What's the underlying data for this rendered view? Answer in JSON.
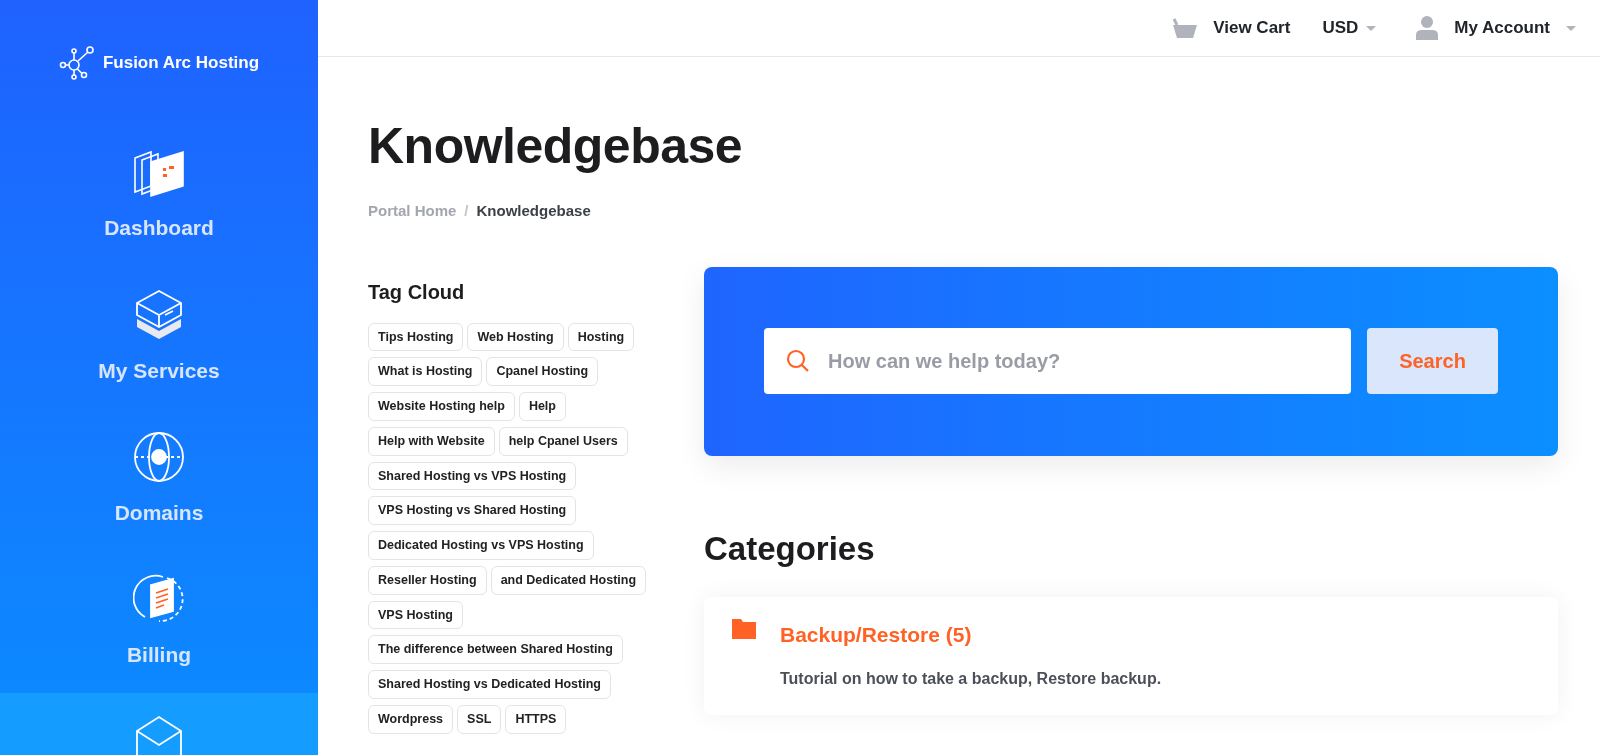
{
  "brand": {
    "name": "Fusion Arc Hosting"
  },
  "sidebar": {
    "items": [
      {
        "label": "Dashboard",
        "selected": false
      },
      {
        "label": "My Services",
        "selected": false
      },
      {
        "label": "Domains",
        "selected": false
      },
      {
        "label": "Billing",
        "selected": false
      },
      {
        "selected": true
      }
    ]
  },
  "topbar": {
    "cart": "View Cart",
    "currency": "USD",
    "account": "My Account"
  },
  "page": {
    "title": "Knowledgebase",
    "breadcrumb_separator": "/",
    "breadcrumb": [
      {
        "label": "Portal Home",
        "active": false
      },
      {
        "label": "Knowledgebase",
        "active": true
      }
    ]
  },
  "tag_cloud": {
    "title": "Tag Cloud",
    "tags": [
      "Tips Hosting",
      "Web Hosting",
      "Hosting",
      "What is Hosting",
      "Cpanel Hosting",
      "Website Hosting help",
      "Help",
      "Help with Website",
      "help Cpanel Users",
      "Shared Hosting vs VPS Hosting",
      "VPS Hosting vs Shared Hosting",
      "Dedicated Hosting vs VPS Hosting",
      "Reseller Hosting",
      "and Dedicated Hosting",
      "VPS Hosting",
      "The difference between Shared Hosting",
      "Shared Hosting vs Dedicated Hosting",
      "Wordpress",
      "SSL",
      "HTTPS"
    ]
  },
  "search": {
    "placeholder": "How can we help today?",
    "button": "Search"
  },
  "categories": {
    "title": "Categories",
    "items": [
      {
        "name": "Backup/Restore (5)",
        "description": "Tutorial on how to take a backup, Restore backup."
      }
    ]
  }
}
